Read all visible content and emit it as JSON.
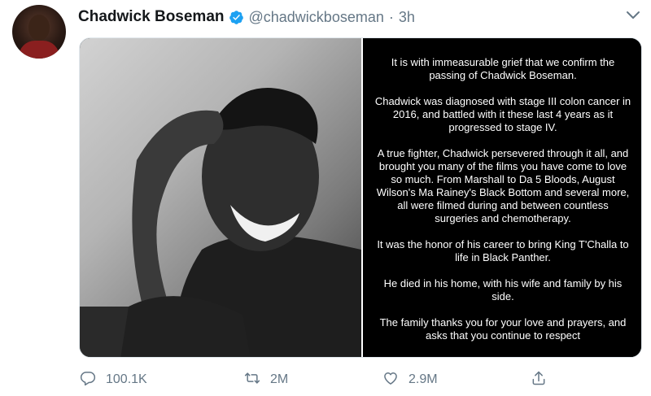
{
  "tweet": {
    "author_name": "Chadwick Boseman",
    "handle": "@chadwickboseman",
    "separator": "·",
    "time": "3h",
    "statement_paragraphs": [
      "It is with immeasurable grief that we confirm the passing of Chadwick Boseman.",
      "Chadwick was diagnosed with stage III colon cancer in 2016, and battled with it these last 4 years as it progressed to stage IV.",
      "A true fighter, Chadwick persevered through it all, and brought you many of the films you have come to love so much. From Marshall to Da 5 Bloods, August Wilson's Ma Rainey's Black Bottom and several more, all were filmed during and between countless surgeries and chemotherapy.",
      "It was the honor of his career to bring King T'Challa to life in Black Panther.",
      "He died in his home, with his wife and family by his side.",
      "The family thanks you for your love and prayers, and asks that you continue to respect"
    ]
  },
  "actions": {
    "reply_count": "100.1K",
    "retweet_count": "2M",
    "like_count": "2.9M"
  },
  "icons": {
    "avatar": "profile-photo",
    "verified": "verified-badge-icon",
    "caret": "chevron-down-icon",
    "reply": "reply-icon",
    "retweet": "retweet-icon",
    "like": "heart-icon",
    "share": "share-icon"
  },
  "colors": {
    "verified_blue": "#1da1f2",
    "secondary_text": "#657786",
    "primary_text": "#14171a"
  }
}
